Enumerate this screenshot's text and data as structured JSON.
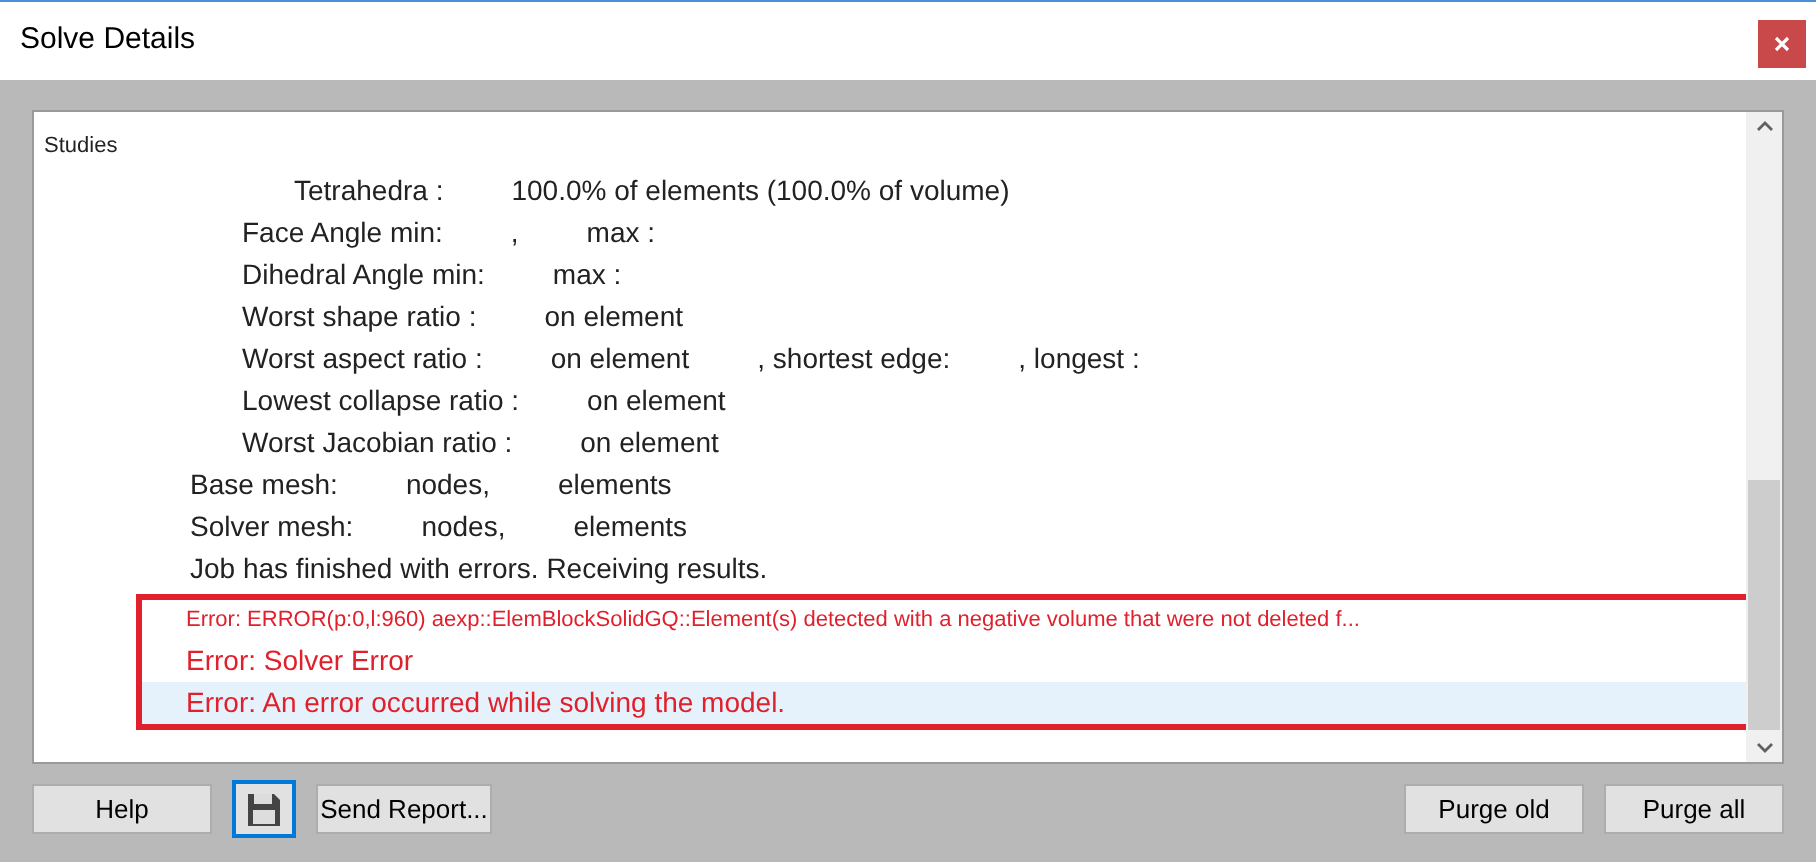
{
  "window": {
    "title": "Solve Details"
  },
  "panel": {
    "title": "Studies"
  },
  "log": [
    {
      "children": [
        {
          "children": [
            {
              "parts": [
                "Tetrahedra :",
                "100.0% of elements (100.0% of volume)"
              ]
            }
          ]
        },
        {
          "parts": [
            "Face Angle min:",
            ",",
            "max :"
          ]
        },
        {
          "parts": [
            "Dihedral Angle min:",
            "max :"
          ]
        },
        {
          "parts": [
            "Worst shape ratio :",
            "on element"
          ]
        },
        {
          "parts": [
            "Worst aspect ratio :",
            "on element",
            ", shortest edge:",
            ", longest :"
          ]
        },
        {
          "parts": [
            "Lowest collapse ratio :",
            "on element"
          ]
        },
        {
          "parts": [
            "Worst Jacobian ratio :",
            "on element"
          ]
        }
      ]
    },
    {
      "parts": [
        "Base mesh:",
        "nodes,",
        "elements"
      ]
    },
    {
      "parts": [
        "Solver mesh:",
        "nodes,",
        "elements"
      ]
    },
    {
      "parts": [
        "Job has finished with errors. Receiving results."
      ]
    }
  ],
  "errors": [
    {
      "kind": "detail",
      "text": "Error: ERROR(p:0,l:960) aexp::ElemBlockSolidGQ::Element(s) detected with a negative volume that were not deleted f...",
      "selected": false
    },
    {
      "kind": "message",
      "text": "Error: Solver Error",
      "selected": false
    },
    {
      "kind": "message",
      "text": "Error: An error occurred while solving the model.",
      "selected": true
    }
  ],
  "buttons_left": [
    "Help",
    "Send Report..."
  ],
  "buttons_right": [
    "Purge old",
    "Purge all"
  ]
}
